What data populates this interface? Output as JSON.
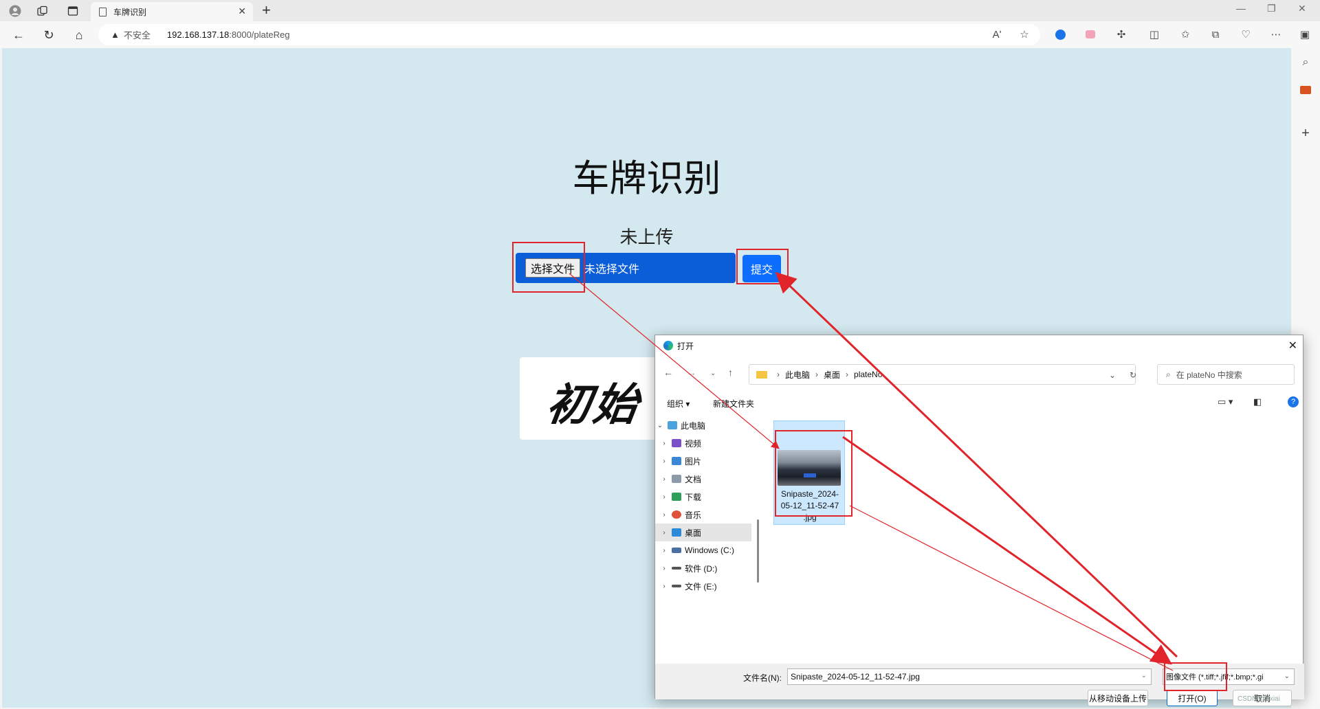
{
  "browser": {
    "tab_title": "车牌识别",
    "tab_close": "✕",
    "new_tab": "+",
    "security_label": "不安全",
    "url_host": "192.168.137.18",
    "url_path": ":8000/plateReg",
    "read_aloud": "Aʹ"
  },
  "page": {
    "title": "车牌识别",
    "status": "未上传",
    "choose_file_button": "选择文件",
    "no_file_text": "未选择文件",
    "submit_button": "提交",
    "image_text": "初始"
  },
  "dialog": {
    "title": "打开",
    "breadcrumb": [
      "此电脑",
      "桌面",
      "plateNo"
    ],
    "search_placeholder": "在 plateNo 中搜索",
    "organize": "组织 ▾",
    "new_folder": "新建文件夹",
    "help": "?",
    "tree": [
      {
        "label": "此电脑",
        "chevron": "⌄",
        "color": "#4aa3df"
      },
      {
        "label": "视频",
        "chevron": "›",
        "color": "#7b4fc9"
      },
      {
        "label": "图片",
        "chevron": "›",
        "color": "#3a87d6"
      },
      {
        "label": "文档",
        "chevron": "›",
        "color": "#8e9aa8"
      },
      {
        "label": "下载",
        "chevron": "›",
        "color": "#2e9e5b"
      },
      {
        "label": "音乐",
        "chevron": "›",
        "color": "#e0533a"
      },
      {
        "label": "桌面",
        "chevron": "›",
        "color": "#2d8ad8"
      },
      {
        "label": "Windows (C:)",
        "chevron": "›",
        "color": "#4a6fa5"
      },
      {
        "label": "软件 (D:)",
        "chevron": "›",
        "color": "#555555"
      },
      {
        "label": "文件 (E:)",
        "chevron": "›",
        "color": "#555555"
      }
    ],
    "file_name_lines": [
      "Snipaste_2024-",
      "05-12_11-52-47",
      ".jpg"
    ],
    "filename_label": "文件名(N):",
    "filename_value": "Snipaste_2024-05-12_11-52-47.jpg",
    "filetype_value": "图像文件 (*.tiff;*.jfif;*.bmp;*.gi",
    "upload_mobile": "从移动设备上传",
    "open_button": "打开(O)",
    "cancel_button": "取消"
  },
  "watermark": "CSDN @hxiai",
  "colors": {
    "page_bg": "#d3e9ef",
    "file_box": "#0b5ed7",
    "submit": "#0d6efd",
    "annotation": "#e0242a"
  }
}
